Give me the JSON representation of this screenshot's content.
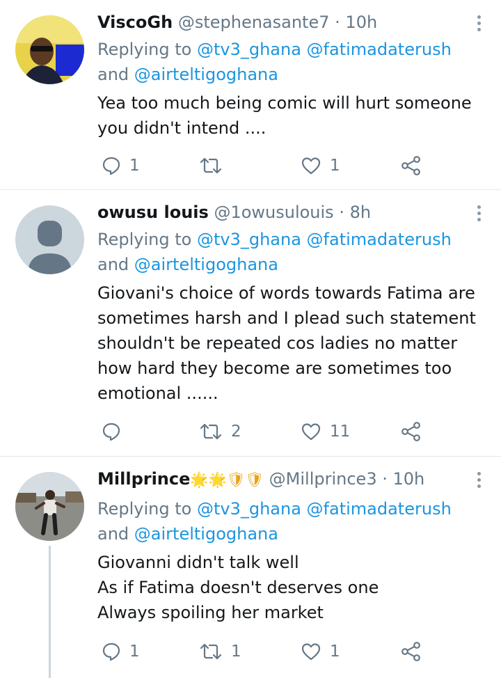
{
  "tweets": [
    {
      "name": "ViscoGh",
      "handle": "@stephenasante7",
      "time": "10h",
      "reply_prefix": "Replying to",
      "reply_to_1": "@tv3_ghana",
      "reply_to_2": "@fatimadaterush",
      "reply_and": "and",
      "reply_to_3": "@airteltigoghana",
      "lines": [
        "Yea too much being comic will hurt someone",
        "you didn't intend ...."
      ],
      "replies": "1",
      "retweets": "",
      "likes": "1",
      "avatar": "photo-man-sunglasses"
    },
    {
      "name": "owusu louis",
      "handle": "@1owusulouis",
      "time": "8h",
      "reply_prefix": "Replying to",
      "reply_to_1": "@tv3_ghana",
      "reply_to_2": "@fatimadaterush",
      "reply_and": "and",
      "reply_to_3": "@airteltigoghana",
      "lines": [
        "Giovani's choice of words towards Fatima are",
        "sometimes harsh and I plead such statement",
        "shouldn't be repeated cos ladies no matter",
        "how hard they become are sometimes too",
        "emotional ......"
      ],
      "replies": "",
      "retweets": "2",
      "likes": "11",
      "avatar": "default-profile-placeholder"
    },
    {
      "name": "Millprince",
      "name_emoji": "🌟🌟🛡🛡",
      "handle": "@Millprince3",
      "time": "10h",
      "reply_prefix": "Replying to",
      "reply_to_1": "@tv3_ghana",
      "reply_to_2": "@fatimadaterush",
      "reply_and": "and",
      "reply_to_3": "@airteltigoghana",
      "lines": [
        "Giovanni didn't talk well",
        "As if Fatima doesn't deserves one",
        "Always spoiling her market"
      ],
      "replies": "1",
      "retweets": "1",
      "likes": "1",
      "avatar": "photo-person-street"
    }
  ],
  "separator": "·",
  "colors": {
    "link": "#1b95e0",
    "muted": "#657786",
    "divider": "#e1e8ed",
    "icon": "#657786"
  }
}
